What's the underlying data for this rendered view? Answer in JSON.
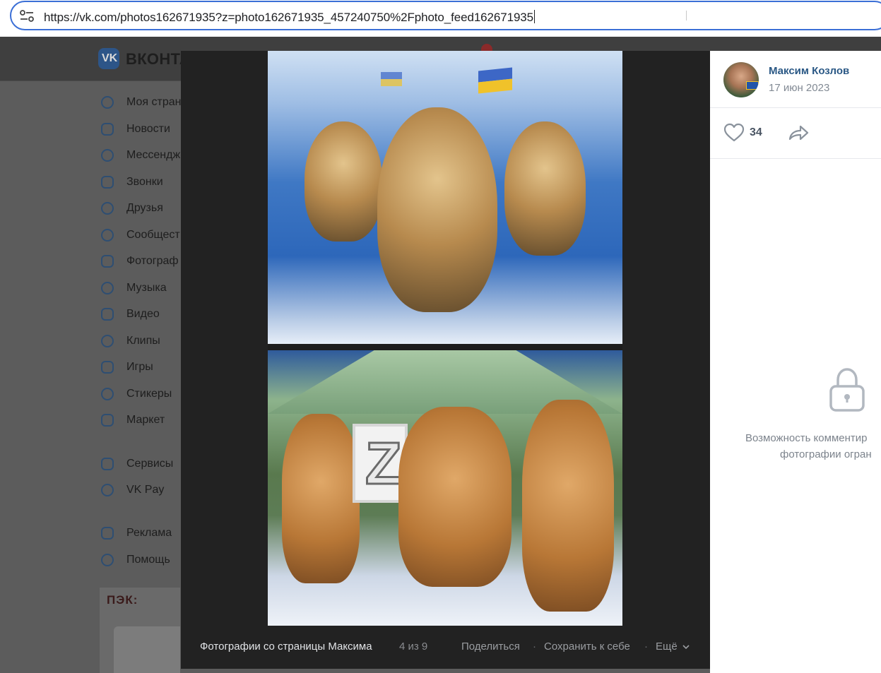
{
  "browser": {
    "url": "https://vk.com/photos162671935?z=photo162671935_457240750%2Fphoto_feed162671935"
  },
  "vk": {
    "logo_text": "VK",
    "wordmark": "ВКОНТА",
    "sidebar": {
      "items": [
        {
          "label": "Моя стран",
          "icon": "user-icon"
        },
        {
          "label": "Новости",
          "icon": "news-icon"
        },
        {
          "label": "Мессендж",
          "icon": "message-icon"
        },
        {
          "label": "Звонки",
          "icon": "phone-icon"
        },
        {
          "label": "Друзья",
          "icon": "friends-icon"
        },
        {
          "label": "Сообщест",
          "icon": "communities-icon"
        },
        {
          "label": "Фотограф",
          "icon": "photo-icon"
        },
        {
          "label": "Музыка",
          "icon": "music-icon"
        },
        {
          "label": "Видео",
          "icon": "video-icon"
        },
        {
          "label": "Клипы",
          "icon": "clips-icon"
        },
        {
          "label": "Игры",
          "icon": "games-icon"
        },
        {
          "label": "Стикеры",
          "icon": "stickers-icon"
        },
        {
          "label": "Маркет",
          "icon": "market-icon"
        },
        {
          "label": "Сервисы",
          "icon": "services-icon"
        },
        {
          "label": "VK Pay",
          "icon": "vkpay-icon"
        },
        {
          "label": "Реклама",
          "icon": "ads-icon"
        },
        {
          "label": "Помощь",
          "icon": "help-icon"
        }
      ]
    },
    "ad_logo": "ПЭК:"
  },
  "viewer": {
    "album_title": "Фотографии со страницы Максима",
    "counter": "4 из 9",
    "actions": {
      "share": "Поделиться",
      "save": "Сохранить к себе",
      "more": "Ещё"
    },
    "photo_plate": "Z"
  },
  "panel": {
    "author": "Максим Козлов",
    "date": "17 июн 2023",
    "likes": "34",
    "comments_notice_line1": "Возможность комментир",
    "comments_notice_line2": "фотографии огран"
  },
  "colors": {
    "link_blue": "#2a5885",
    "focus_blue": "#3b6fd6",
    "viewer_bg": "#222222"
  }
}
